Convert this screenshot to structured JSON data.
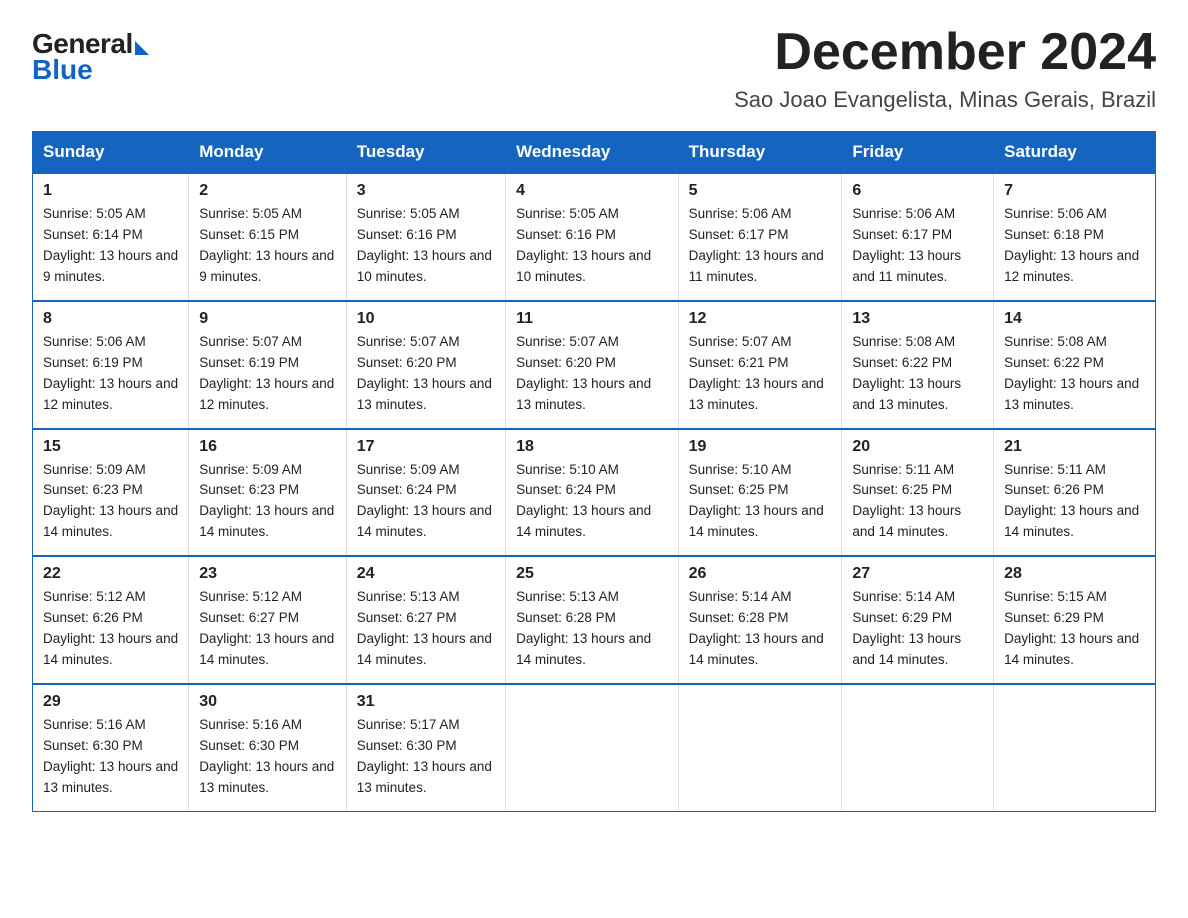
{
  "logo": {
    "general": "General",
    "blue": "Blue"
  },
  "title": "December 2024",
  "subtitle": "Sao Joao Evangelista, Minas Gerais, Brazil",
  "days_of_week": [
    "Sunday",
    "Monday",
    "Tuesday",
    "Wednesday",
    "Thursday",
    "Friday",
    "Saturday"
  ],
  "weeks": [
    [
      {
        "day": "1",
        "sunrise": "5:05 AM",
        "sunset": "6:14 PM",
        "daylight": "13 hours and 9 minutes."
      },
      {
        "day": "2",
        "sunrise": "5:05 AM",
        "sunset": "6:15 PM",
        "daylight": "13 hours and 9 minutes."
      },
      {
        "day": "3",
        "sunrise": "5:05 AM",
        "sunset": "6:16 PM",
        "daylight": "13 hours and 10 minutes."
      },
      {
        "day": "4",
        "sunrise": "5:05 AM",
        "sunset": "6:16 PM",
        "daylight": "13 hours and 10 minutes."
      },
      {
        "day": "5",
        "sunrise": "5:06 AM",
        "sunset": "6:17 PM",
        "daylight": "13 hours and 11 minutes."
      },
      {
        "day": "6",
        "sunrise": "5:06 AM",
        "sunset": "6:17 PM",
        "daylight": "13 hours and 11 minutes."
      },
      {
        "day": "7",
        "sunrise": "5:06 AM",
        "sunset": "6:18 PM",
        "daylight": "13 hours and 12 minutes."
      }
    ],
    [
      {
        "day": "8",
        "sunrise": "5:06 AM",
        "sunset": "6:19 PM",
        "daylight": "13 hours and 12 minutes."
      },
      {
        "day": "9",
        "sunrise": "5:07 AM",
        "sunset": "6:19 PM",
        "daylight": "13 hours and 12 minutes."
      },
      {
        "day": "10",
        "sunrise": "5:07 AM",
        "sunset": "6:20 PM",
        "daylight": "13 hours and 13 minutes."
      },
      {
        "day": "11",
        "sunrise": "5:07 AM",
        "sunset": "6:20 PM",
        "daylight": "13 hours and 13 minutes."
      },
      {
        "day": "12",
        "sunrise": "5:07 AM",
        "sunset": "6:21 PM",
        "daylight": "13 hours and 13 minutes."
      },
      {
        "day": "13",
        "sunrise": "5:08 AM",
        "sunset": "6:22 PM",
        "daylight": "13 hours and 13 minutes."
      },
      {
        "day": "14",
        "sunrise": "5:08 AM",
        "sunset": "6:22 PM",
        "daylight": "13 hours and 13 minutes."
      }
    ],
    [
      {
        "day": "15",
        "sunrise": "5:09 AM",
        "sunset": "6:23 PM",
        "daylight": "13 hours and 14 minutes."
      },
      {
        "day": "16",
        "sunrise": "5:09 AM",
        "sunset": "6:23 PM",
        "daylight": "13 hours and 14 minutes."
      },
      {
        "day": "17",
        "sunrise": "5:09 AM",
        "sunset": "6:24 PM",
        "daylight": "13 hours and 14 minutes."
      },
      {
        "day": "18",
        "sunrise": "5:10 AM",
        "sunset": "6:24 PM",
        "daylight": "13 hours and 14 minutes."
      },
      {
        "day": "19",
        "sunrise": "5:10 AM",
        "sunset": "6:25 PM",
        "daylight": "13 hours and 14 minutes."
      },
      {
        "day": "20",
        "sunrise": "5:11 AM",
        "sunset": "6:25 PM",
        "daylight": "13 hours and 14 minutes."
      },
      {
        "day": "21",
        "sunrise": "5:11 AM",
        "sunset": "6:26 PM",
        "daylight": "13 hours and 14 minutes."
      }
    ],
    [
      {
        "day": "22",
        "sunrise": "5:12 AM",
        "sunset": "6:26 PM",
        "daylight": "13 hours and 14 minutes."
      },
      {
        "day": "23",
        "sunrise": "5:12 AM",
        "sunset": "6:27 PM",
        "daylight": "13 hours and 14 minutes."
      },
      {
        "day": "24",
        "sunrise": "5:13 AM",
        "sunset": "6:27 PM",
        "daylight": "13 hours and 14 minutes."
      },
      {
        "day": "25",
        "sunrise": "5:13 AM",
        "sunset": "6:28 PM",
        "daylight": "13 hours and 14 minutes."
      },
      {
        "day": "26",
        "sunrise": "5:14 AM",
        "sunset": "6:28 PM",
        "daylight": "13 hours and 14 minutes."
      },
      {
        "day": "27",
        "sunrise": "5:14 AM",
        "sunset": "6:29 PM",
        "daylight": "13 hours and 14 minutes."
      },
      {
        "day": "28",
        "sunrise": "5:15 AM",
        "sunset": "6:29 PM",
        "daylight": "13 hours and 14 minutes."
      }
    ],
    [
      {
        "day": "29",
        "sunrise": "5:16 AM",
        "sunset": "6:30 PM",
        "daylight": "13 hours and 13 minutes."
      },
      {
        "day": "30",
        "sunrise": "5:16 AM",
        "sunset": "6:30 PM",
        "daylight": "13 hours and 13 minutes."
      },
      {
        "day": "31",
        "sunrise": "5:17 AM",
        "sunset": "6:30 PM",
        "daylight": "13 hours and 13 minutes."
      },
      null,
      null,
      null,
      null
    ]
  ],
  "labels": {
    "sunrise_prefix": "Sunrise: ",
    "sunset_prefix": "Sunset: ",
    "daylight_prefix": "Daylight: "
  }
}
